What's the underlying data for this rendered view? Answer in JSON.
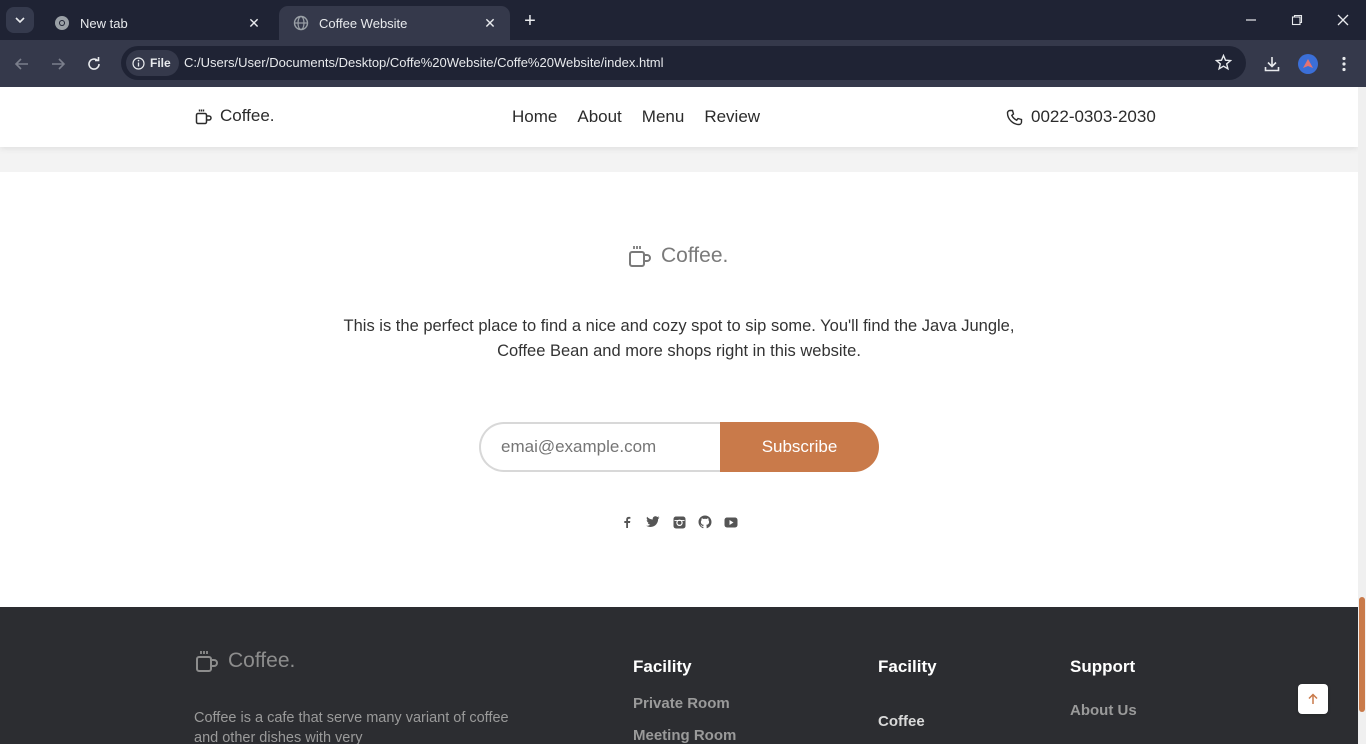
{
  "browser": {
    "tabs": [
      {
        "title": "New tab",
        "active": false,
        "icon": "chrome-icon"
      },
      {
        "title": "Coffee Website",
        "active": true,
        "icon": "globe-icon"
      }
    ],
    "chip_label": "File",
    "url": "C:/Users/User/Documents/Desktop/Coffe%20Website/Coffe%20Website/index.html"
  },
  "navbar": {
    "brand": "Coffee.",
    "links": [
      "Home",
      "About",
      "Menu",
      "Review"
    ],
    "phone": "0022-0303-2030"
  },
  "newsletter": {
    "brand": "Coffee.",
    "text": "This is the perfect place to find a nice and cozy spot to sip some. You'll find the Java Jungle, Coffee Bean and more shops right in this website.",
    "email_placeholder": "emai@example.com",
    "button_label": "Subscribe",
    "socials": [
      "facebook-icon",
      "twitter-icon",
      "instagram-icon",
      "github-icon",
      "youtube-icon"
    ]
  },
  "footer": {
    "brand": "Coffee.",
    "description": "Coffee is a cafe that serve many variant of coffee and other dishes with very",
    "columns": [
      {
        "heading": "Facility",
        "items": [
          "Private Room",
          "Meeting Room"
        ]
      },
      {
        "heading": "Facility",
        "items": [
          "Coffee"
        ]
      },
      {
        "heading": "Support",
        "items": [
          "About Us"
        ]
      }
    ]
  },
  "colors": {
    "accent": "#c97a4a",
    "footer_bg": "#2c2d31",
    "chrome_dark": "#1f2334",
    "chrome_mid": "#35394b"
  }
}
